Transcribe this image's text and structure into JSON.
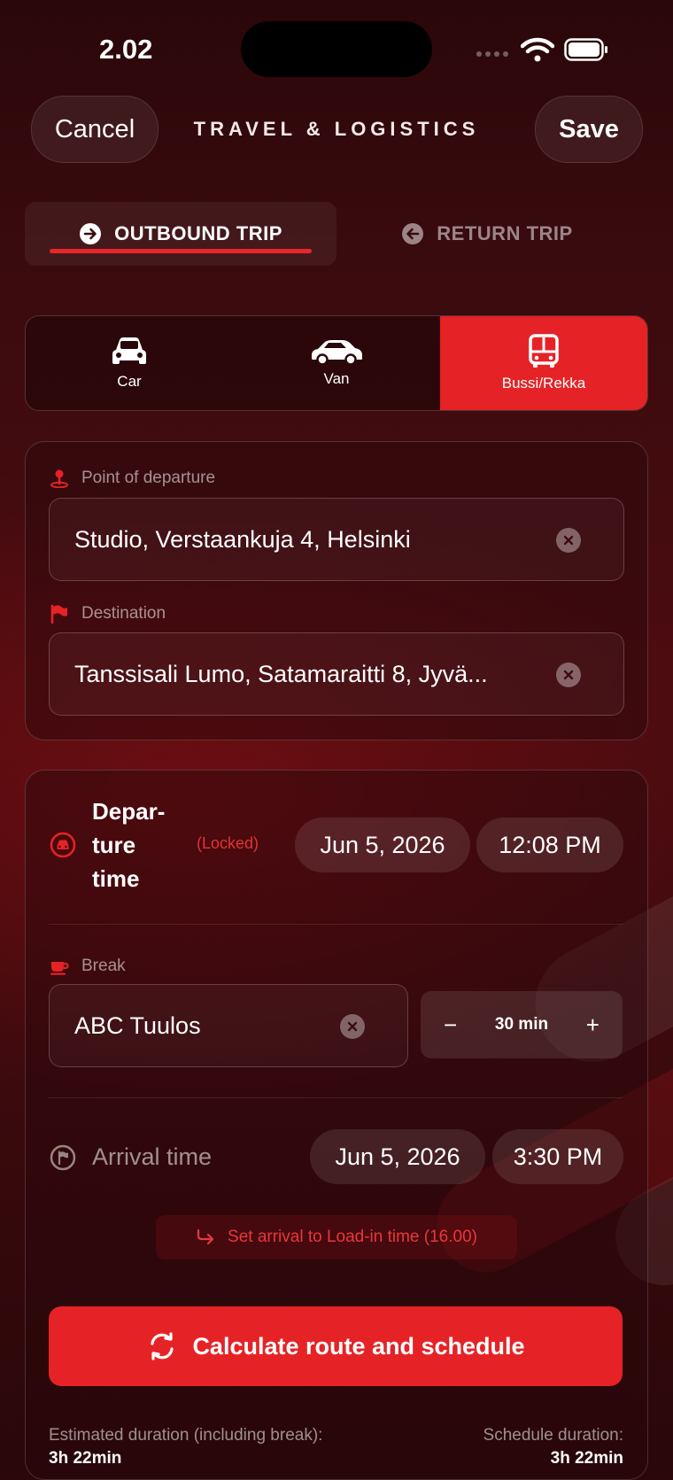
{
  "status": {
    "time": "2.02"
  },
  "header": {
    "cancel": "Cancel",
    "title": "TRAVEL & LOGISTICS",
    "save": "Save"
  },
  "trip_tabs": [
    {
      "label": "OUTBOUND TRIP",
      "icon": "arrow-right-circle-icon",
      "active": true
    },
    {
      "label": "RETURN TRIP",
      "icon": "arrow-left-circle-icon",
      "active": false
    }
  ],
  "vehicles": [
    {
      "label": "Car",
      "icon": "car-icon",
      "selected": false
    },
    {
      "label": "Van",
      "icon": "van-icon",
      "selected": false
    },
    {
      "label": "Bussi/Rekka",
      "icon": "bus-icon",
      "selected": true
    }
  ],
  "route": {
    "departure_label": "Point of departure",
    "departure_value": "Studio, Verstaankuja 4, Helsinki",
    "destination_label": "Destination",
    "destination_value": "Tanssisali Lumo, Satamaraitti 8, Jyvä..."
  },
  "schedule": {
    "departure_label": "Depar-ture time",
    "departure_label_lines": [
      "Depar-",
      "ture",
      "time"
    ],
    "locked": "(Locked)",
    "departure_date": "Jun 5, 2026",
    "departure_time": "12:08 PM",
    "break_label": "Break",
    "break_value": "ABC Tuulos",
    "break_duration": "30 min",
    "minus": "−",
    "plus": "+",
    "arrival_label": "Arrival time",
    "arrival_date": "Jun 5, 2026",
    "arrival_time": "3:30 PM",
    "suggestion": "Set arrival to Load-in time (16.00)",
    "calculate": "Calculate route and schedule",
    "estimated_label": "Estimated duration (including break):",
    "estimated_value": "3h 22min",
    "schedule_label": "Schedule duration:",
    "schedule_value": "3h 22min"
  },
  "colors": {
    "accent": "#e52326",
    "background": "#3a0b0e"
  }
}
